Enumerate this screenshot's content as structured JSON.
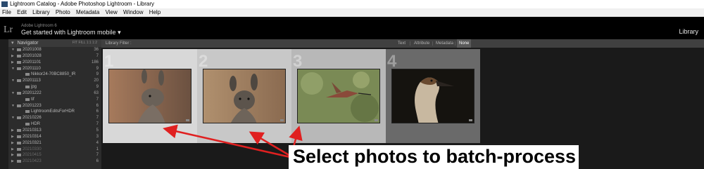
{
  "window": {
    "title": "Lightroom Catalog - Adobe Photoshop Lightroom - Library"
  },
  "menu": [
    "File",
    "Edit",
    "Library",
    "Photo",
    "Metadata",
    "View",
    "Window",
    "Help"
  ],
  "identity": {
    "logo": "Lr",
    "product": "Adobe Lightroom 6",
    "message": "Get started with Lightroom mobile",
    "module": "Library"
  },
  "navigator": {
    "label": "Navigator",
    "zoom": "FIT  FILL  1:1  1:2"
  },
  "folders": [
    {
      "name": "20201008",
      "count": "36",
      "indent": 1,
      "expanded": true
    },
    {
      "name": "20201028",
      "count": "7",
      "indent": 1,
      "expanded": false
    },
    {
      "name": "20201101",
      "count": "186",
      "indent": 1,
      "expanded": false
    },
    {
      "name": "20201110",
      "count": "9",
      "indent": 1,
      "expanded": true
    },
    {
      "name": "Nikkor24-70BC8850_IR",
      "count": "9",
      "indent": 2,
      "expanded": false
    },
    {
      "name": "20201113",
      "count": "20",
      "indent": 1,
      "expanded": true
    },
    {
      "name": "jpg",
      "count": "9",
      "indent": 2,
      "expanded": false
    },
    {
      "name": "20201222",
      "count": "63",
      "indent": 1,
      "expanded": true
    },
    {
      "name": "tif",
      "count": "7",
      "indent": 2,
      "expanded": false
    },
    {
      "name": "20201223",
      "count": "6",
      "indent": 1,
      "expanded": true
    },
    {
      "name": "LightroomEditsForHDR",
      "count": "6",
      "indent": 2,
      "expanded": false
    },
    {
      "name": "20210226",
      "count": "7",
      "indent": 1,
      "expanded": true
    },
    {
      "name": "HDR",
      "count": "7",
      "indent": 2,
      "expanded": false
    },
    {
      "name": "20210313",
      "count": "5",
      "indent": 1,
      "expanded": false
    },
    {
      "name": "20210314",
      "count": "3",
      "indent": 1,
      "expanded": false
    },
    {
      "name": "20210321",
      "count": "4",
      "indent": 1,
      "expanded": false
    },
    {
      "name": "20210330",
      "count": "1",
      "indent": 1,
      "expanded": false,
      "dim": true
    },
    {
      "name": "20210415",
      "count": "7",
      "indent": 1,
      "expanded": false,
      "dim": true
    },
    {
      "name": "20210423",
      "count": "6",
      "indent": 1,
      "expanded": false,
      "dim": true
    }
  ],
  "filter_bar": {
    "title": "Library Filter :",
    "options": [
      "Text",
      "Attribute",
      "Metadata",
      "None"
    ],
    "active": "None"
  },
  "grid": [
    {
      "num": "1",
      "label": "kangaroo",
      "selected": true,
      "cell_bg": "#d8d8d8"
    },
    {
      "num": "2",
      "label": "kangaroo",
      "selected": true,
      "cell_bg": "#c8c8c8"
    },
    {
      "num": "3",
      "label": "hummingbird",
      "selected": true,
      "cell_bg": "#b8b8b8"
    },
    {
      "num": "4",
      "label": "goose",
      "selected": false,
      "cell_bg": "#6a6a6a"
    }
  ],
  "annotation": {
    "caption": "Select photos to batch-process",
    "arrow_color": "#e02020"
  }
}
